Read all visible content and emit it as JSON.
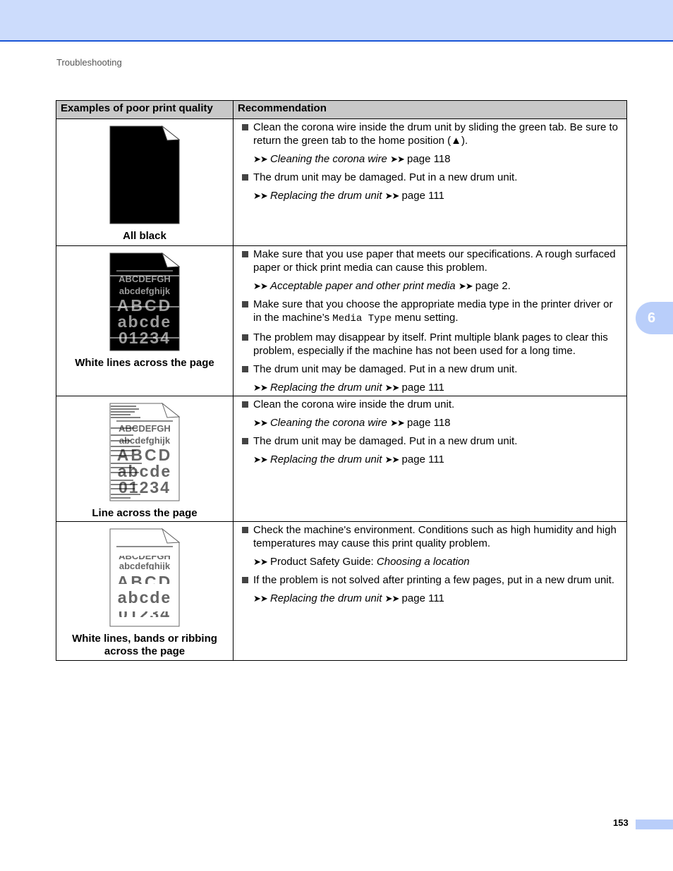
{
  "header": {
    "running_title": "Troubleshooting"
  },
  "chapter_tab": {
    "label": "6"
  },
  "footer": {
    "page_number": "153"
  },
  "table": {
    "headers": [
      "Examples of poor print quality",
      "Recommendation"
    ],
    "sample_text": {
      "line1": "ABCDEFGH",
      "line2": "abcdefghijk",
      "line3": "ABCD",
      "line4": "abcde",
      "line5": "01234"
    },
    "rows": [
      {
        "caption": "All black",
        "items": [
          {
            "type": "bullet",
            "text": "Clean the corona wire inside the drum unit by sliding the green tab. Be sure to return the green tab to the home position (▲)."
          },
          {
            "type": "ref",
            "prefix": "",
            "link": "Cleaning the corona wire",
            "page": "page 118"
          },
          {
            "type": "bullet",
            "text": "The drum unit may be damaged. Put in a new drum unit."
          },
          {
            "type": "ref",
            "prefix": "",
            "link": "Replacing the drum unit",
            "page": "page 111"
          }
        ]
      },
      {
        "caption": "White lines across the page",
        "items": [
          {
            "type": "bullet",
            "text": "Make sure that you use paper that meets our specifications. A rough surfaced paper or thick print media can cause this problem."
          },
          {
            "type": "ref",
            "prefix": "",
            "link": "Acceptable paper and other print media",
            "page": "page 2."
          },
          {
            "type": "bullet",
            "text_before": "Make sure that you choose the appropriate media type in the printer driver or in the machine’s ",
            "code": "Media Type",
            "text_after": " menu setting."
          },
          {
            "type": "bullet",
            "text": "The problem may disappear by itself. Print multiple blank pages to clear this problem, especially if the machine has not been used for a long time."
          },
          {
            "type": "bullet",
            "text": "The drum unit may be damaged. Put in a new drum unit."
          },
          {
            "type": "ref",
            "prefix": "",
            "link": "Replacing the drum unit",
            "page": "page 111"
          }
        ]
      },
      {
        "caption": "Line across the page",
        "items": [
          {
            "type": "bullet",
            "text": "Clean the corona wire inside the drum unit."
          },
          {
            "type": "ref",
            "prefix": "",
            "link": "Cleaning the corona wire",
            "page": "page 118"
          },
          {
            "type": "bullet",
            "text": "The drum unit may be damaged. Put in a new drum unit."
          },
          {
            "type": "ref",
            "prefix": "",
            "link": "Replacing the drum unit",
            "page": "page 111"
          }
        ]
      },
      {
        "caption_line1": "White lines, bands or ribbing",
        "caption_line2": "across the page",
        "items": [
          {
            "type": "bullet",
            "text": "Check the machine's environment. Conditions such as high humidity and high temperatures may cause this print quality problem."
          },
          {
            "type": "ref",
            "prefix": "Product Safety Guide: ",
            "link": "Choosing a location",
            "page": ""
          },
          {
            "type": "bullet",
            "text": "If the problem is not solved after printing a few pages, put in a new drum unit."
          },
          {
            "type": "ref",
            "prefix": "",
            "link": "Replacing the drum unit",
            "page": "page 111"
          }
        ]
      }
    ],
    "ref_arrow": "➤➤"
  }
}
